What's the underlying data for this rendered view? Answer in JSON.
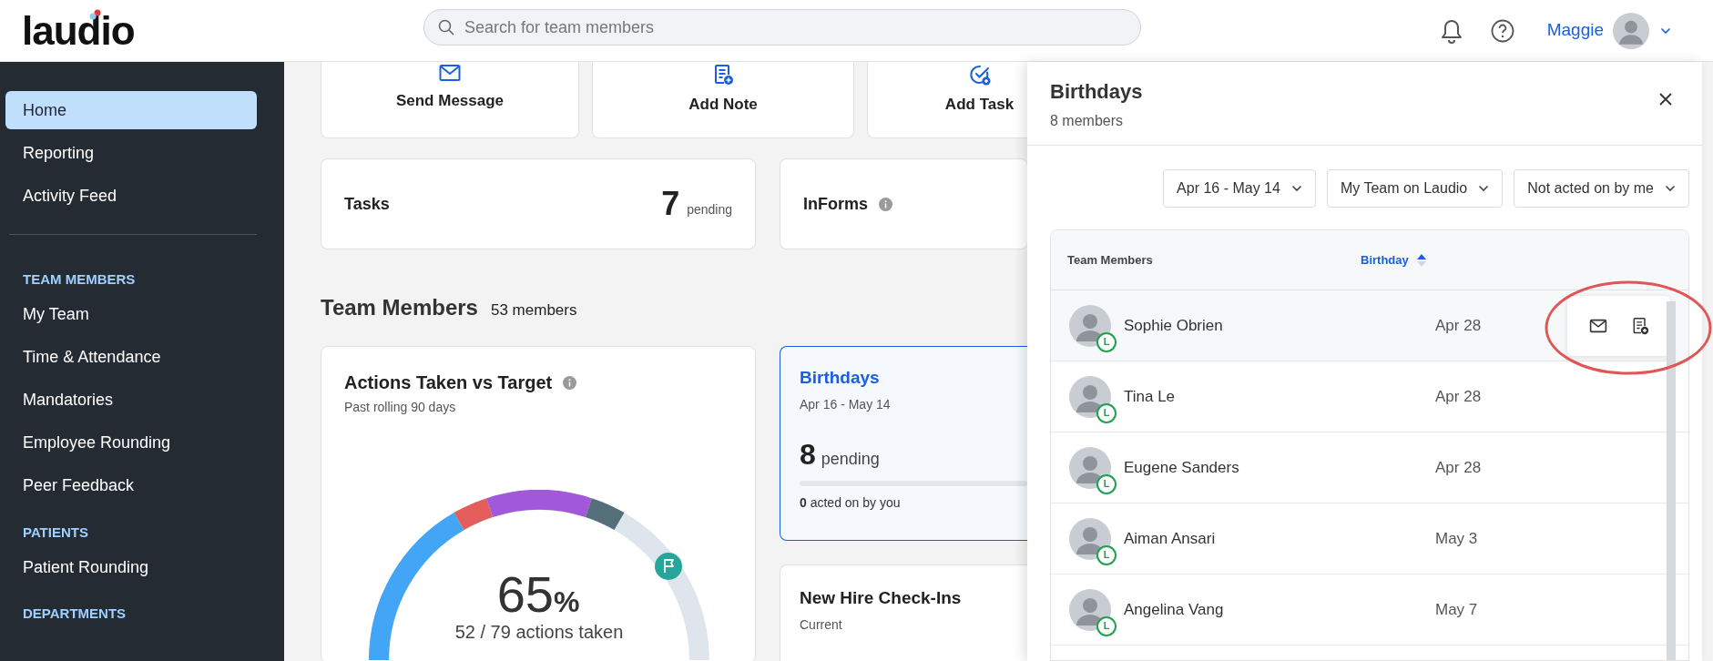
{
  "top_bar": {
    "logo": "laudio",
    "search": {
      "placeholder": "Search for team members"
    },
    "user": {
      "name": "Maggie"
    }
  },
  "sidebar": {
    "items": [
      {
        "kind": "item",
        "label": "Home",
        "selected": true
      },
      {
        "kind": "item",
        "label": "Reporting",
        "selected": false
      },
      {
        "kind": "item",
        "label": "Activity Feed",
        "selected": false
      },
      {
        "kind": "divider"
      },
      {
        "kind": "section",
        "label": "TEAM MEMBERS"
      },
      {
        "kind": "item",
        "label": "My Team",
        "selected": false
      },
      {
        "kind": "item",
        "label": "Time & Attendance",
        "selected": false
      },
      {
        "kind": "item",
        "label": "Mandatories",
        "selected": false
      },
      {
        "kind": "item",
        "label": "Employee Rounding",
        "selected": false
      },
      {
        "kind": "item",
        "label": "Peer Feedback",
        "selected": false
      },
      {
        "kind": "section",
        "label": "PATIENTS"
      },
      {
        "kind": "item",
        "label": "Patient Rounding",
        "selected": false
      },
      {
        "kind": "section",
        "label": "DEPARTMENTS"
      }
    ]
  },
  "quick_actions": [
    {
      "kind": "message",
      "label": "Send Message"
    },
    {
      "kind": "note",
      "label": "Add Note"
    },
    {
      "kind": "task",
      "label": "Add Task"
    }
  ],
  "summary_cards": [
    {
      "title": "Tasks",
      "count": "7",
      "count_label": "pending"
    },
    {
      "title": "InForms",
      "info": true
    }
  ],
  "team_members": {
    "title": "Team Members",
    "count": "53 members"
  },
  "actions_card": {
    "title": "Actions Taken vs Target",
    "subtitle": "Past rolling 90 days",
    "percent": "65",
    "percent_sign": "%",
    "reading": "52 / 79 actions taken",
    "info": true
  },
  "birthdays_card": {
    "title": "Birthdays",
    "range": "Apr 16 - May 14",
    "count": "8",
    "count_label": "pending",
    "level": 0,
    "acted": "**0** acted on by you",
    "selected": true
  },
  "new_hire_card": {
    "title": "New Hire Check-Ins",
    "subtitle": "Current"
  },
  "panel": {
    "title": "Birthdays",
    "subtitle": "8 members",
    "filters": [
      "Apr 16 - May 14",
      "My Team on Laudio",
      "Not acted on by me"
    ],
    "columns": [
      {
        "label": "Team Members",
        "sorted": false
      },
      {
        "label": "Birthday",
        "sorted": true
      }
    ],
    "rows": [
      {
        "name": "Sophie Obrien",
        "badge": "L",
        "birthday": "Apr 28",
        "hovered": true
      },
      {
        "name": "Tina Le",
        "badge": "L",
        "birthday": "Apr 28",
        "hovered": false
      },
      {
        "name": "Eugene Sanders",
        "badge": "L",
        "birthday": "Apr 28",
        "hovered": false
      },
      {
        "name": "Aiman Ansari",
        "badge": "L",
        "birthday": "May 3",
        "hovered": false
      },
      {
        "name": "Angelina Vang",
        "badge": "L",
        "birthday": "May 7",
        "hovered": false
      }
    ]
  }
}
